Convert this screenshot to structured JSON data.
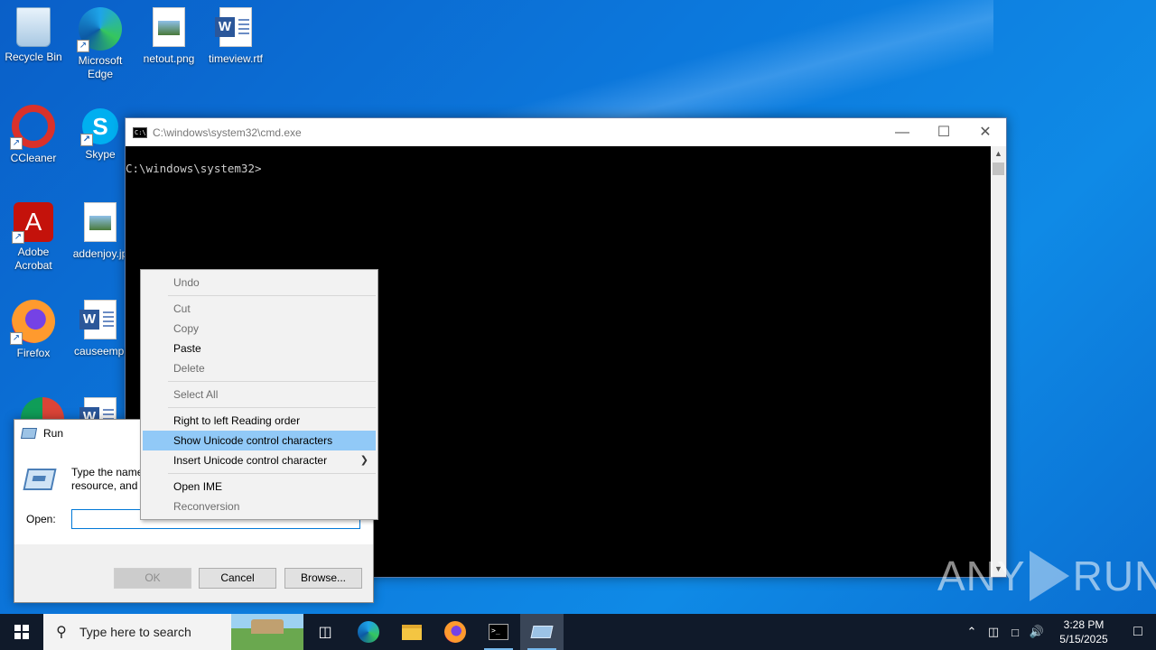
{
  "desktop": {
    "icons": [
      {
        "label": "Recycle Bin",
        "icon": "recycle-bin-icon"
      },
      {
        "label": "Microsoft Edge",
        "icon": "edge-icon"
      },
      {
        "label": "netout.png",
        "icon": "image-file-icon"
      },
      {
        "label": "timeview.rtf",
        "icon": "word-doc-icon"
      },
      {
        "label": "CCleaner",
        "icon": "ccleaner-icon"
      },
      {
        "label": "Skype",
        "icon": "skype-icon"
      },
      {
        "label": "Adobe Acrobat",
        "icon": "acrobat-icon"
      },
      {
        "label": "addenjoy.jp",
        "icon": "image-file-icon"
      },
      {
        "label": "Firefox",
        "icon": "firefox-icon"
      },
      {
        "label": "causeempl",
        "icon": "word-doc-icon"
      }
    ]
  },
  "cmd": {
    "title": "C:\\windows\\system32\\cmd.exe",
    "prompt": "C:\\windows\\system32>"
  },
  "run": {
    "title": "Run",
    "description": "Type the name of a program, folder, document, or Internet resource, and Windows will open it for you.",
    "description_visible": "Type the name\nresource, and W",
    "open_label": "Open:",
    "input_value": "",
    "ok": "OK",
    "cancel": "Cancel",
    "browse": "Browse..."
  },
  "context_menu": {
    "items": [
      {
        "label": "Undo",
        "enabled": false
      },
      {
        "label": "Cut",
        "enabled": false
      },
      {
        "label": "Copy",
        "enabled": false
      },
      {
        "label": "Paste",
        "enabled": true
      },
      {
        "label": "Delete",
        "enabled": false
      },
      {
        "label": "Select All",
        "enabled": false
      },
      {
        "label": "Right to left Reading order",
        "enabled": true
      },
      {
        "label": "Show Unicode control characters",
        "enabled": true,
        "highlighted": true
      },
      {
        "label": "Insert Unicode control character",
        "enabled": true,
        "submenu": true
      },
      {
        "label": "Open IME",
        "enabled": true
      },
      {
        "label": "Reconversion",
        "enabled": false
      }
    ]
  },
  "taskbar": {
    "search_placeholder": "Type here to search",
    "time": "3:28 PM",
    "date": "5/15/2025"
  },
  "watermark": {
    "left": "ANY",
    "right": "RUN"
  },
  "colors": {
    "desktop": "#0c78dc",
    "menu_highlight": "#91c9f7",
    "taskbar": "#101a2a"
  }
}
